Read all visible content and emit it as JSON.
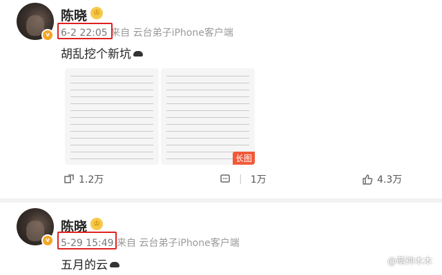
{
  "post1": {
    "name": "陈晓",
    "time": "6-2 22:05",
    "source": "来自 云台弟子iPhone客户端",
    "text": "胡乱挖个新坑",
    "image_badge": "长图",
    "actions": {
      "repost": "1.2万",
      "comment": "1万",
      "like": "4.3万"
    }
  },
  "post2": {
    "name": "陈晓",
    "time": "5-29 15:49",
    "source": "来自 云台弟子iPhone客户端",
    "text": "五月的云"
  },
  "watermark": "@萌神木木",
  "colors": {
    "highlight": "#e02020",
    "badge": "#f5a623"
  }
}
